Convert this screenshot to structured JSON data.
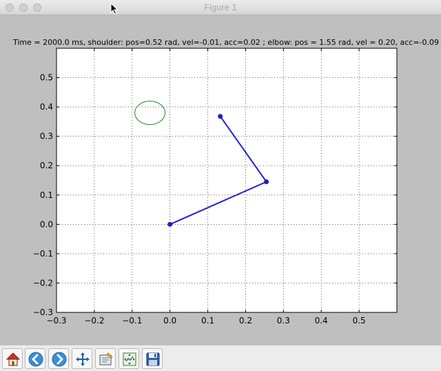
{
  "window": {
    "title": "Figure 1"
  },
  "toolbar": {
    "buttons": [
      {
        "name": "home-button",
        "icon": "home-icon"
      },
      {
        "name": "back-button",
        "icon": "back-arrow-icon"
      },
      {
        "name": "forward-button",
        "icon": "forward-arrow-icon"
      },
      {
        "name": "pan-button",
        "icon": "move-arrows-icon"
      },
      {
        "name": "zoom-button",
        "icon": "zoom-rect-icon"
      },
      {
        "name": "subplots-button",
        "icon": "configure-subplots-icon"
      },
      {
        "name": "save-button",
        "icon": "save-disk-icon"
      }
    ]
  },
  "chart_data": {
    "type": "line",
    "title": "Time = 2000.0 ms, shoulder: pos=0.52 rad, vel=-0.01, acc=0.02 ; elbow: pos = 1.55 rad, vel = 0.20, acc=-0.09",
    "xlim": [
      -0.3,
      0.6
    ],
    "ylim": [
      -0.3,
      0.6
    ],
    "xticks": [
      "−0.3",
      "−0.2",
      "−0.1",
      "0.0",
      "0.1",
      "0.2",
      "0.3",
      "0.4",
      "0.5"
    ],
    "xtick_values": [
      -0.3,
      -0.2,
      -0.1,
      0.0,
      0.1,
      0.2,
      0.3,
      0.4,
      0.5
    ],
    "yticks": [
      "−0.3",
      "−0.2",
      "−0.1",
      "0.0",
      "0.1",
      "0.2",
      "0.3",
      "0.4",
      "0.5"
    ],
    "ytick_values": [
      -0.3,
      -0.2,
      -0.1,
      0.0,
      0.1,
      0.2,
      0.3,
      0.4,
      0.5
    ],
    "grid": true,
    "arm": {
      "x": [
        0.0,
        0.255,
        0.133
      ],
      "y": [
        0.0,
        0.145,
        0.368
      ],
      "color": "#1f1fd6"
    },
    "target_ellipse": {
      "cx": -0.053,
      "cy": 0.38,
      "rx": 0.04,
      "ry": 0.04,
      "color": "#1a7f1a"
    }
  }
}
